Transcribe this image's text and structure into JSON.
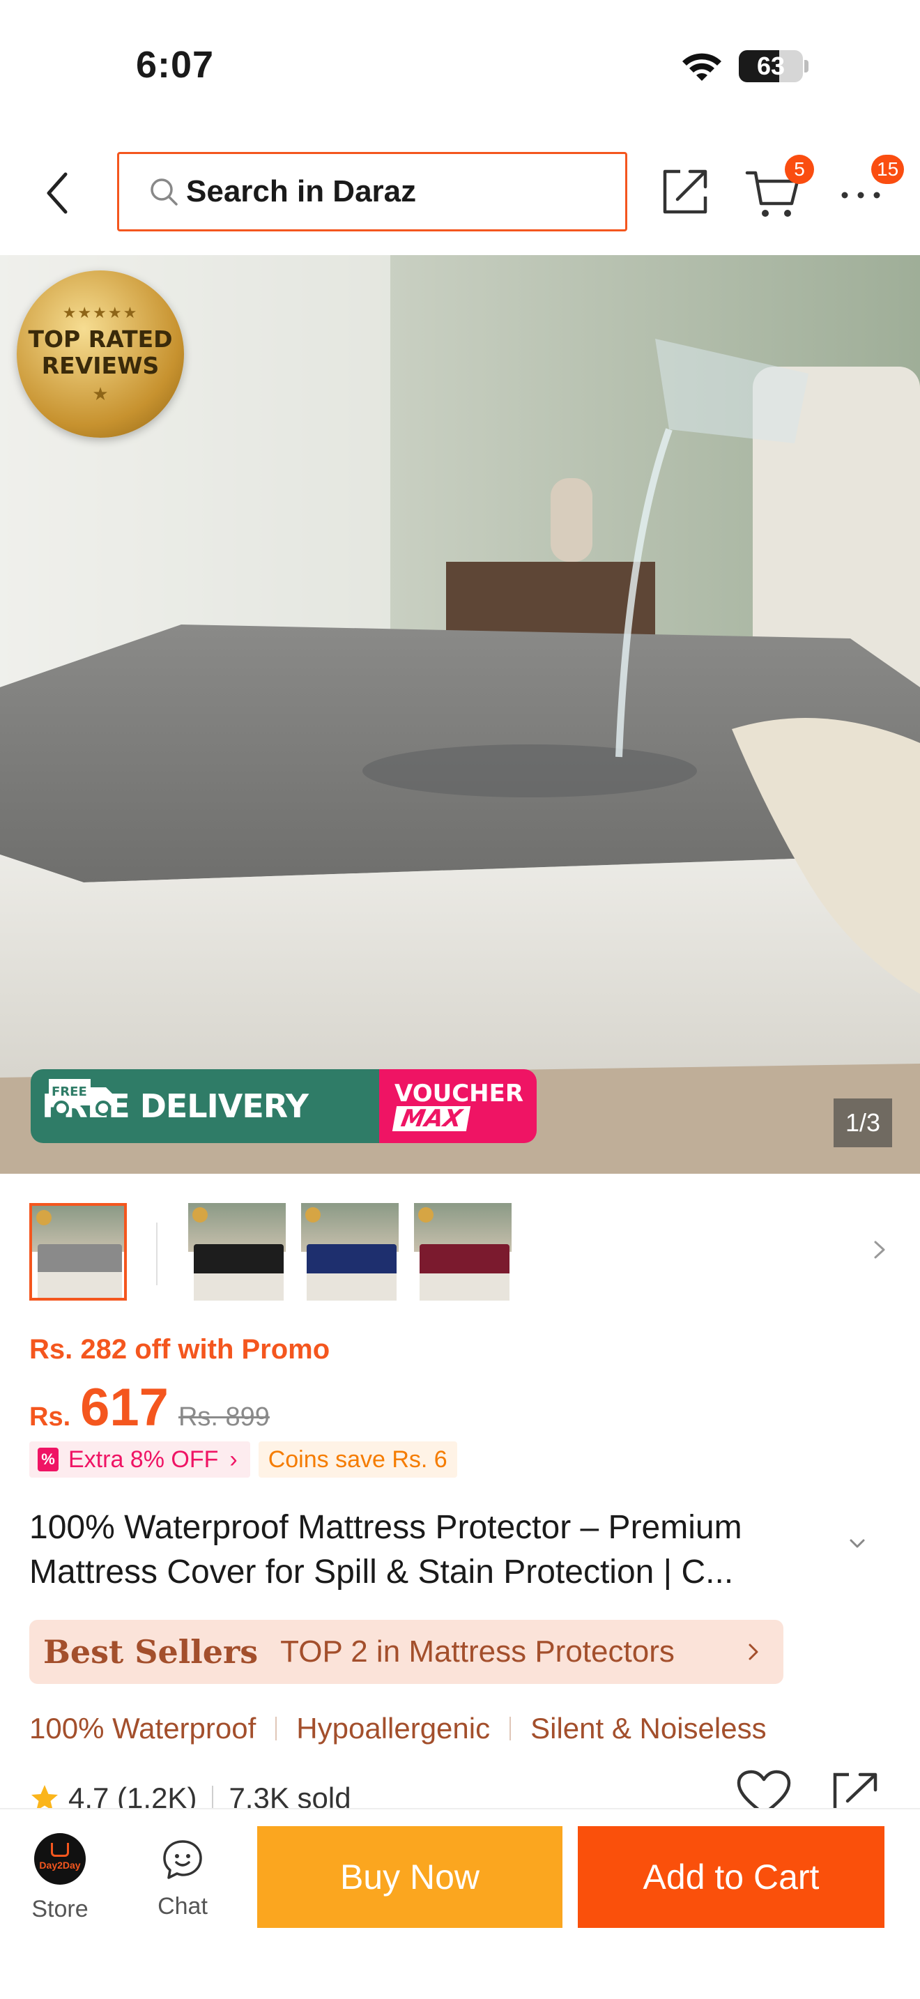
{
  "status_bar": {
    "time": "6:07",
    "battery": "63",
    "battery_level": 0.63
  },
  "header": {
    "search_placeholder": "Search in Daraz",
    "cart_badge": "5",
    "more_badge": "15"
  },
  "hero": {
    "rated_badge_line1": "TOP RATED",
    "rated_badge_line2": "REVIEWS",
    "delivery_text": "FREE DELIVERY",
    "truck_label": "FREE",
    "voucher_line1": "VOUCHER",
    "voucher_line2": "MAX",
    "page_counter": "1/3"
  },
  "thumbnails": {
    "items": [
      {
        "color": "#8a8a8a",
        "active": true
      },
      {
        "color": "#1d1d1d",
        "active": false
      },
      {
        "color": "#1e2f6e",
        "active": false
      },
      {
        "color": "#7b1a2e",
        "active": false
      }
    ]
  },
  "price": {
    "promo_line": "Rs. 282 off with Promo",
    "currency": "Rs.",
    "value": "617",
    "old_price": "Rs. 899",
    "extra_tag": "Extra 8% OFF",
    "coins_tag": "Coins save Rs. 6"
  },
  "product": {
    "title": "100% Waterproof Mattress Protector – Premium Mattress Cover for Spill & Stain Protection | C..."
  },
  "bestsellers": {
    "title": "Best Sellers",
    "text": "TOP 2 in Mattress Protectors"
  },
  "features": [
    "100% Waterproof",
    "Hypoallergenic",
    "Silent & Noiseless"
  ],
  "rating": {
    "score": "4.7 (1.2K)",
    "sold": "7.3K sold"
  },
  "bottom_bar": {
    "store_label": "Store",
    "store_logo_text": "Day2Day",
    "chat_label": "Chat",
    "buy_now": "Buy Now",
    "add_to_cart": "Add to Cart"
  },
  "colors": {
    "accent": "#f4561e",
    "buy": "#fba61f",
    "cart": "#fa500b",
    "pink": "#ef1464"
  }
}
